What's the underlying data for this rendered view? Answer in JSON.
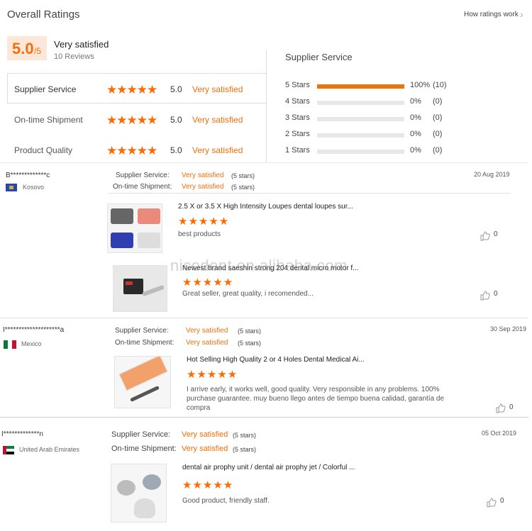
{
  "header": {
    "title": "Overall Ratings",
    "how_link": "How ratings work"
  },
  "summary": {
    "score": "5.0",
    "out_of": "/5",
    "label": "Very satisfied",
    "reviews": "10 Reviews",
    "rows": [
      {
        "name": "Supplier Service",
        "value": "5.0",
        "label": "Very satisfied"
      },
      {
        "name": "On-time Shipment",
        "value": "5.0",
        "label": "Very satisfied"
      },
      {
        "name": "Product Quality",
        "value": "5.0",
        "label": "Very satisfied"
      }
    ]
  },
  "breakdown": {
    "title": "Supplier Service",
    "rows": [
      {
        "label": "5 Stars",
        "pct": "100%",
        "count": "(10)",
        "fill": 1.0
      },
      {
        "label": "4 Stars",
        "pct": "0%",
        "count": "(0)",
        "fill": 0
      },
      {
        "label": "3 Stars",
        "pct": "0%",
        "count": "(0)",
        "fill": 0
      },
      {
        "label": "2 Stars",
        "pct": "0%",
        "count": "(0)",
        "fill": 0
      },
      {
        "label": "1 Stars",
        "pct": "0%",
        "count": "(0)",
        "fill": 0
      }
    ]
  },
  "reviews": [
    {
      "user": "B*************c",
      "country": "Kosovo",
      "date": "20 Aug 2019",
      "service_label": "Supplier Service:",
      "service_value": "Very satisfied",
      "service_stars": "(5 stars)",
      "shipment_label": "On-time Shipment:",
      "shipment_value": "Very satisfied",
      "shipment_stars": "(5 stars)",
      "products": [
        {
          "title": "2.5 X or 3.5 X High Intensity Loupes dental loupes sur...",
          "comment": "best products",
          "likes": "0"
        },
        {
          "title": "Newest brand saeshin strong 204 dental micro motor f...",
          "comment": "Great seller, great quality, i recomended...",
          "likes": "0"
        }
      ]
    },
    {
      "user": "I********************a",
      "country": "Mexico",
      "date": "30 Sep 2019",
      "service_label": "Supplier Service:",
      "service_value": "Very satisfied",
      "service_stars": "(5 stars)",
      "shipment_label": "On-time Shipment:",
      "shipment_value": "Very satisfied",
      "shipment_stars": "(5 stars)",
      "products": [
        {
          "title": "Hot Selling High Quality 2 or 4 Holes Dental Medical Ai...",
          "comment": "I arrive early, it works well, good quality.  Very responsible in any problems.  100% purchase guarantee. muy bueno llego antes de tiempo buena calidad, garantía de compra",
          "likes": "0"
        }
      ]
    },
    {
      "user": "I*************n",
      "country": "United Arab Emirates",
      "date": "05 Oct 2019",
      "service_label": "Supplier Service:",
      "service_value": "Very satisfied",
      "service_stars": "(5 stars)",
      "shipment_label": "On-time Shipment:",
      "shipment_value": "Very satisfied",
      "shipment_stars": "(5 stars)",
      "products": [
        {
          "title": "dental air prophy unit / dental air prophy jet / Colorful ...",
          "comment": "Good product, friendly staff.",
          "likes": "0"
        }
      ]
    }
  ],
  "watermark": "nicodent.en.alibaba.com",
  "colors": {
    "accent": "#f0700a",
    "score_bg": "#fde7d8"
  }
}
